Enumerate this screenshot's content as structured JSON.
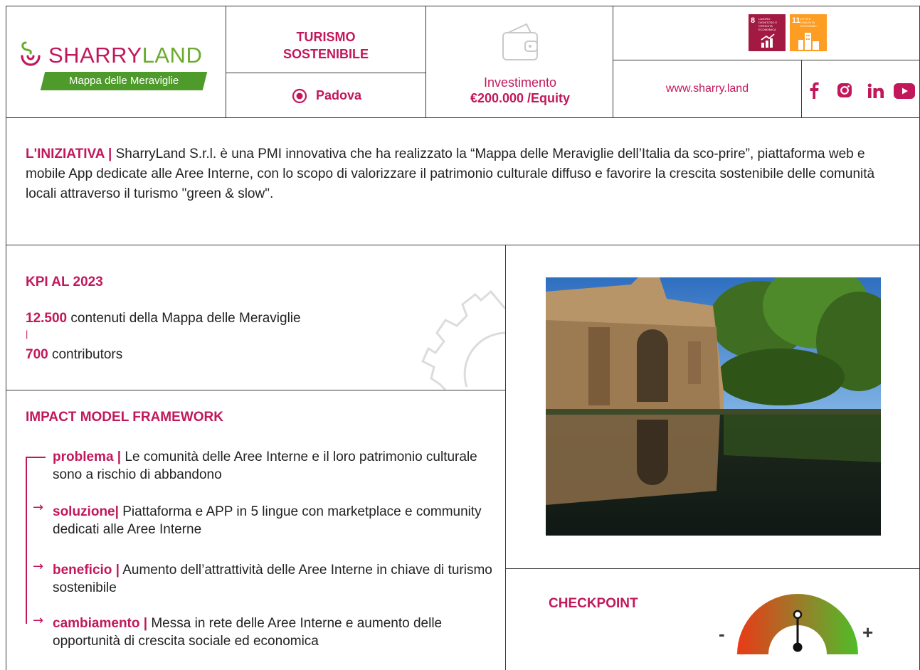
{
  "header": {
    "brand_part1": "SHARRY",
    "brand_part2": "LAND",
    "tagline": "Mappa delle Meraviglie",
    "sector_line1": "TURISMO",
    "sector_line2": "SOSTENIBILE",
    "location": "Padova",
    "investment_label": "Investimento",
    "investment_value": "€200.000 /Equity",
    "website": "www.sharry.land",
    "sdg": [
      {
        "number": "8",
        "text": "LAVORO DIGNITOSO E CRESCITA ECONOMICA",
        "color": "#a21942"
      },
      {
        "number": "11",
        "text": "CITTÀ E COMUNITÀ SOSTENIBILI",
        "color": "#fd9d24"
      }
    ],
    "social_icons": [
      "facebook-icon",
      "instagram-icon",
      "linkedin-icon",
      "youtube-icon"
    ]
  },
  "initiative": {
    "label": "L'INIZIATIVA |",
    "text": " SharryLand S.r.l. è una PMI innovativa che ha realizzato la “Mappa delle Meraviglie dell’Italia da sco-prire”, piattaforma web e mobile App dedicate alle Aree Interne, con lo scopo di valorizzare il patrimonio culturale diffuso e favorire la crescita sostenibile delle comunità locali attraverso il turismo \"green & slow\"."
  },
  "kpi": {
    "title": "KPI AL 2023",
    "items": [
      {
        "value": "12.500",
        "label": " contenuti della Mappa delle Meraviglie"
      },
      {
        "value": "700",
        "label": " contributors"
      }
    ],
    "separator": "|"
  },
  "impact": {
    "title": "IMPACT MODEL FRAMEWORK",
    "items": [
      {
        "label": "problema |",
        "text": " Le comunità delle Aree Interne e il loro patrimonio culturale sono a rischio di abbandono"
      },
      {
        "label": "soluzione|",
        "text": " Piattaforma e APP in 5 lingue con marketplace e community dedicati alle Aree Interne"
      },
      {
        "label": "beneficio |",
        "text": " Aumento dell’attrattività delle Aree Interne in chiave di turismo sostenibile"
      },
      {
        "label": "cambiamento |",
        "text": " Messa in rete delle Aree Interne e aumento delle opportunità di crescita sociale ed economica"
      }
    ]
  },
  "checkpoint": {
    "title": "CHECKPOINT",
    "minus": "-",
    "plus": "+",
    "level": 0.5
  },
  "colors": {
    "accent": "#c2185b",
    "brand_green": "#6aab2e",
    "rule": "#3a3a3a"
  }
}
